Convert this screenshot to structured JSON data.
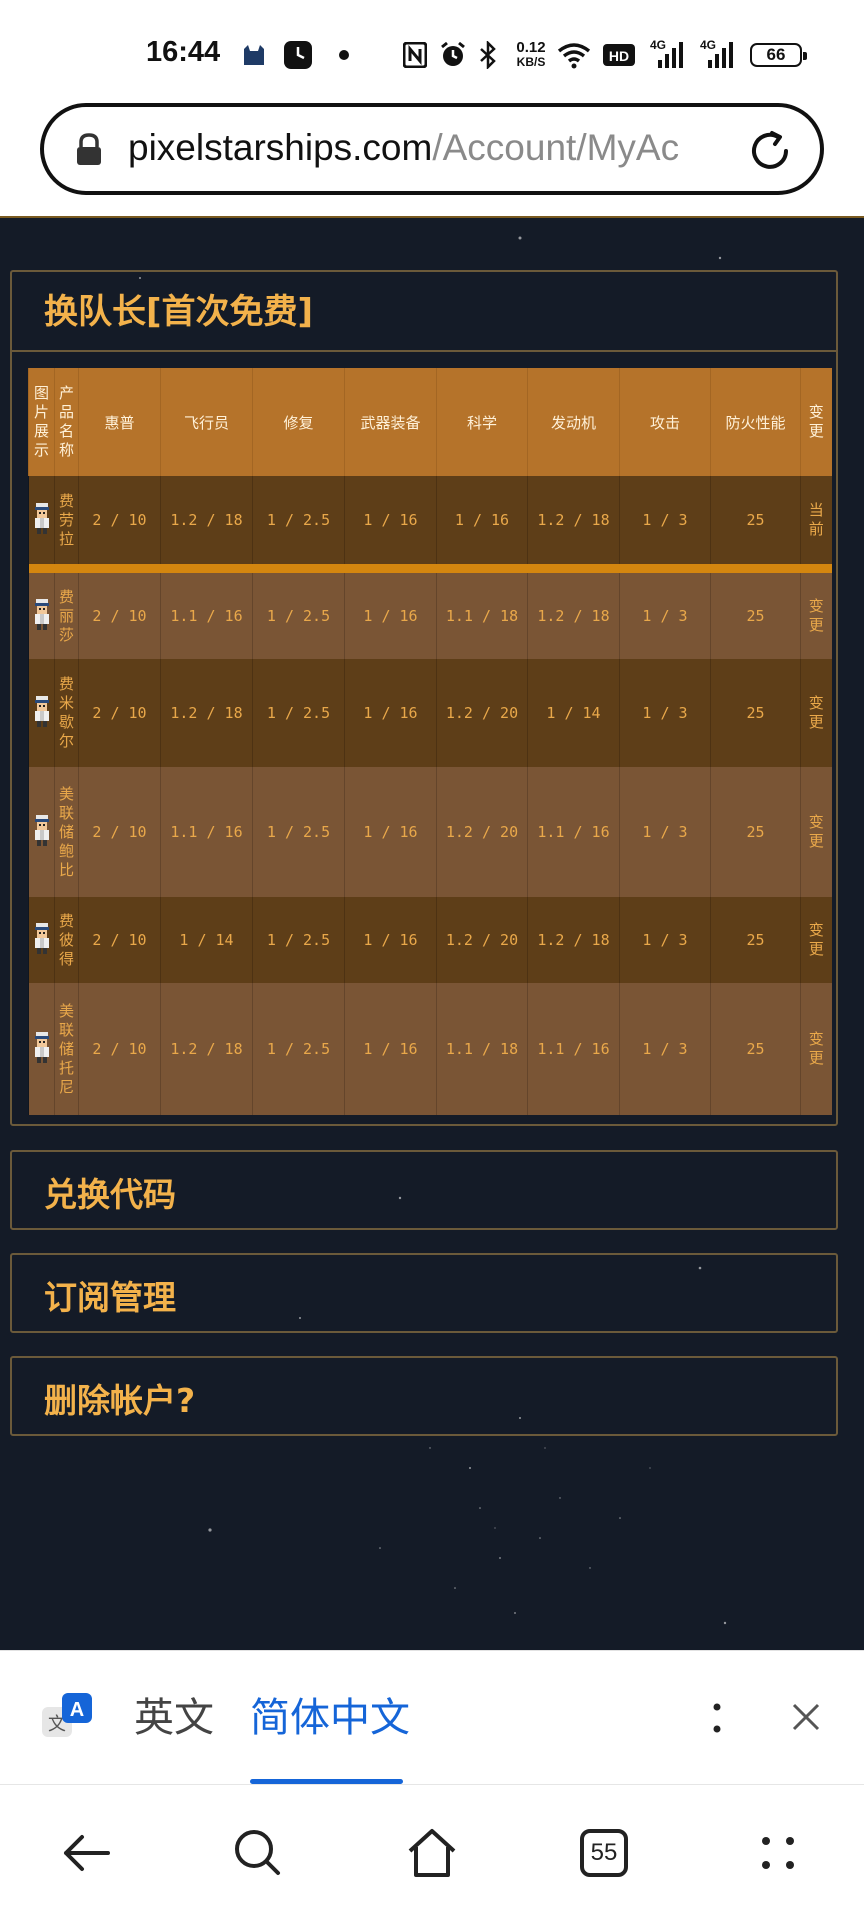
{
  "status_bar": {
    "time": "16:44",
    "net_speed_value": "0.12",
    "net_speed_unit": "KB/S",
    "signal1_label": "4G",
    "signal2_label": "4G",
    "battery": "66",
    "icons": [
      "cat-app-icon",
      "clock-app-icon",
      "dot-icon",
      "nfc-icon",
      "alarm-icon",
      "bluetooth-icon",
      "wifi-icon",
      "hd-icon",
      "signal-icon",
      "signal-icon"
    ]
  },
  "browser": {
    "url_domain": "pixelstarships.com",
    "url_path": "/Account/MyAc"
  },
  "leader_section": {
    "title": "换队长[首次免费]",
    "headers": {
      "image": "图片展示",
      "name": "产品名称",
      "c1": "惠普",
      "c2": "飞行员",
      "c3": "修复",
      "c4": "武器装备",
      "c5": "科学",
      "c6": "发动机",
      "c7": "攻击",
      "c8": "防火性能",
      "action": "变更"
    },
    "rows": [
      {
        "name": "费劳拉",
        "hp": "2 / 10",
        "pilot": "1.2 / 18",
        "repair": "1 / 2.5",
        "weapon": "1 / 16",
        "science": "1 / 16",
        "engine": "1.2 / 18",
        "attack": "1 / 3",
        "fire": "25",
        "action": "当前",
        "current": true
      },
      {
        "name": "费丽莎",
        "hp": "2 / 10",
        "pilot": "1.1 / 16",
        "repair": "1 / 2.5",
        "weapon": "1 / 16",
        "science": "1.1 / 18",
        "engine": "1.2 / 18",
        "attack": "1 / 3",
        "fire": "25",
        "action": "变更"
      },
      {
        "name": "费米歇尔",
        "hp": "2 / 10",
        "pilot": "1.2 / 18",
        "repair": "1 / 2.5",
        "weapon": "1 / 16",
        "science": "1.2 / 20",
        "engine": "1 / 14",
        "attack": "1 / 3",
        "fire": "25",
        "action": "变更"
      },
      {
        "name": "美联储鲍比",
        "hp": "2 / 10",
        "pilot": "1.1 / 16",
        "repair": "1 / 2.5",
        "weapon": "1 / 16",
        "science": "1.2 / 20",
        "engine": "1.1 / 16",
        "attack": "1 / 3",
        "fire": "25",
        "action": "变更"
      },
      {
        "name": "费彼得",
        "hp": "2 / 10",
        "pilot": "1 / 14",
        "repair": "1 / 2.5",
        "weapon": "1 / 16",
        "science": "1.2 / 20",
        "engine": "1.2 / 18",
        "attack": "1 / 3",
        "fire": "25",
        "action": "变更"
      },
      {
        "name": "美联储托尼",
        "hp": "2 / 10",
        "pilot": "1.2 / 18",
        "repair": "1 / 2.5",
        "weapon": "1 / 16",
        "science": "1.1 / 18",
        "engine": "1.1 / 16",
        "attack": "1 / 3",
        "fire": "25",
        "action": "变更"
      }
    ]
  },
  "sections": {
    "redeem": "兑换代码",
    "subscription": "订阅管理",
    "delete": "删除帐户?"
  },
  "translate_bar": {
    "lang_source": "英文",
    "lang_target": "简体中文"
  },
  "nav": {
    "tab_count": "55"
  },
  "colors": {
    "accent_gold": "#f3b24b",
    "header_orange": "#b5732a",
    "page_bg": "#121924",
    "translate_blue": "#1565d8"
  }
}
